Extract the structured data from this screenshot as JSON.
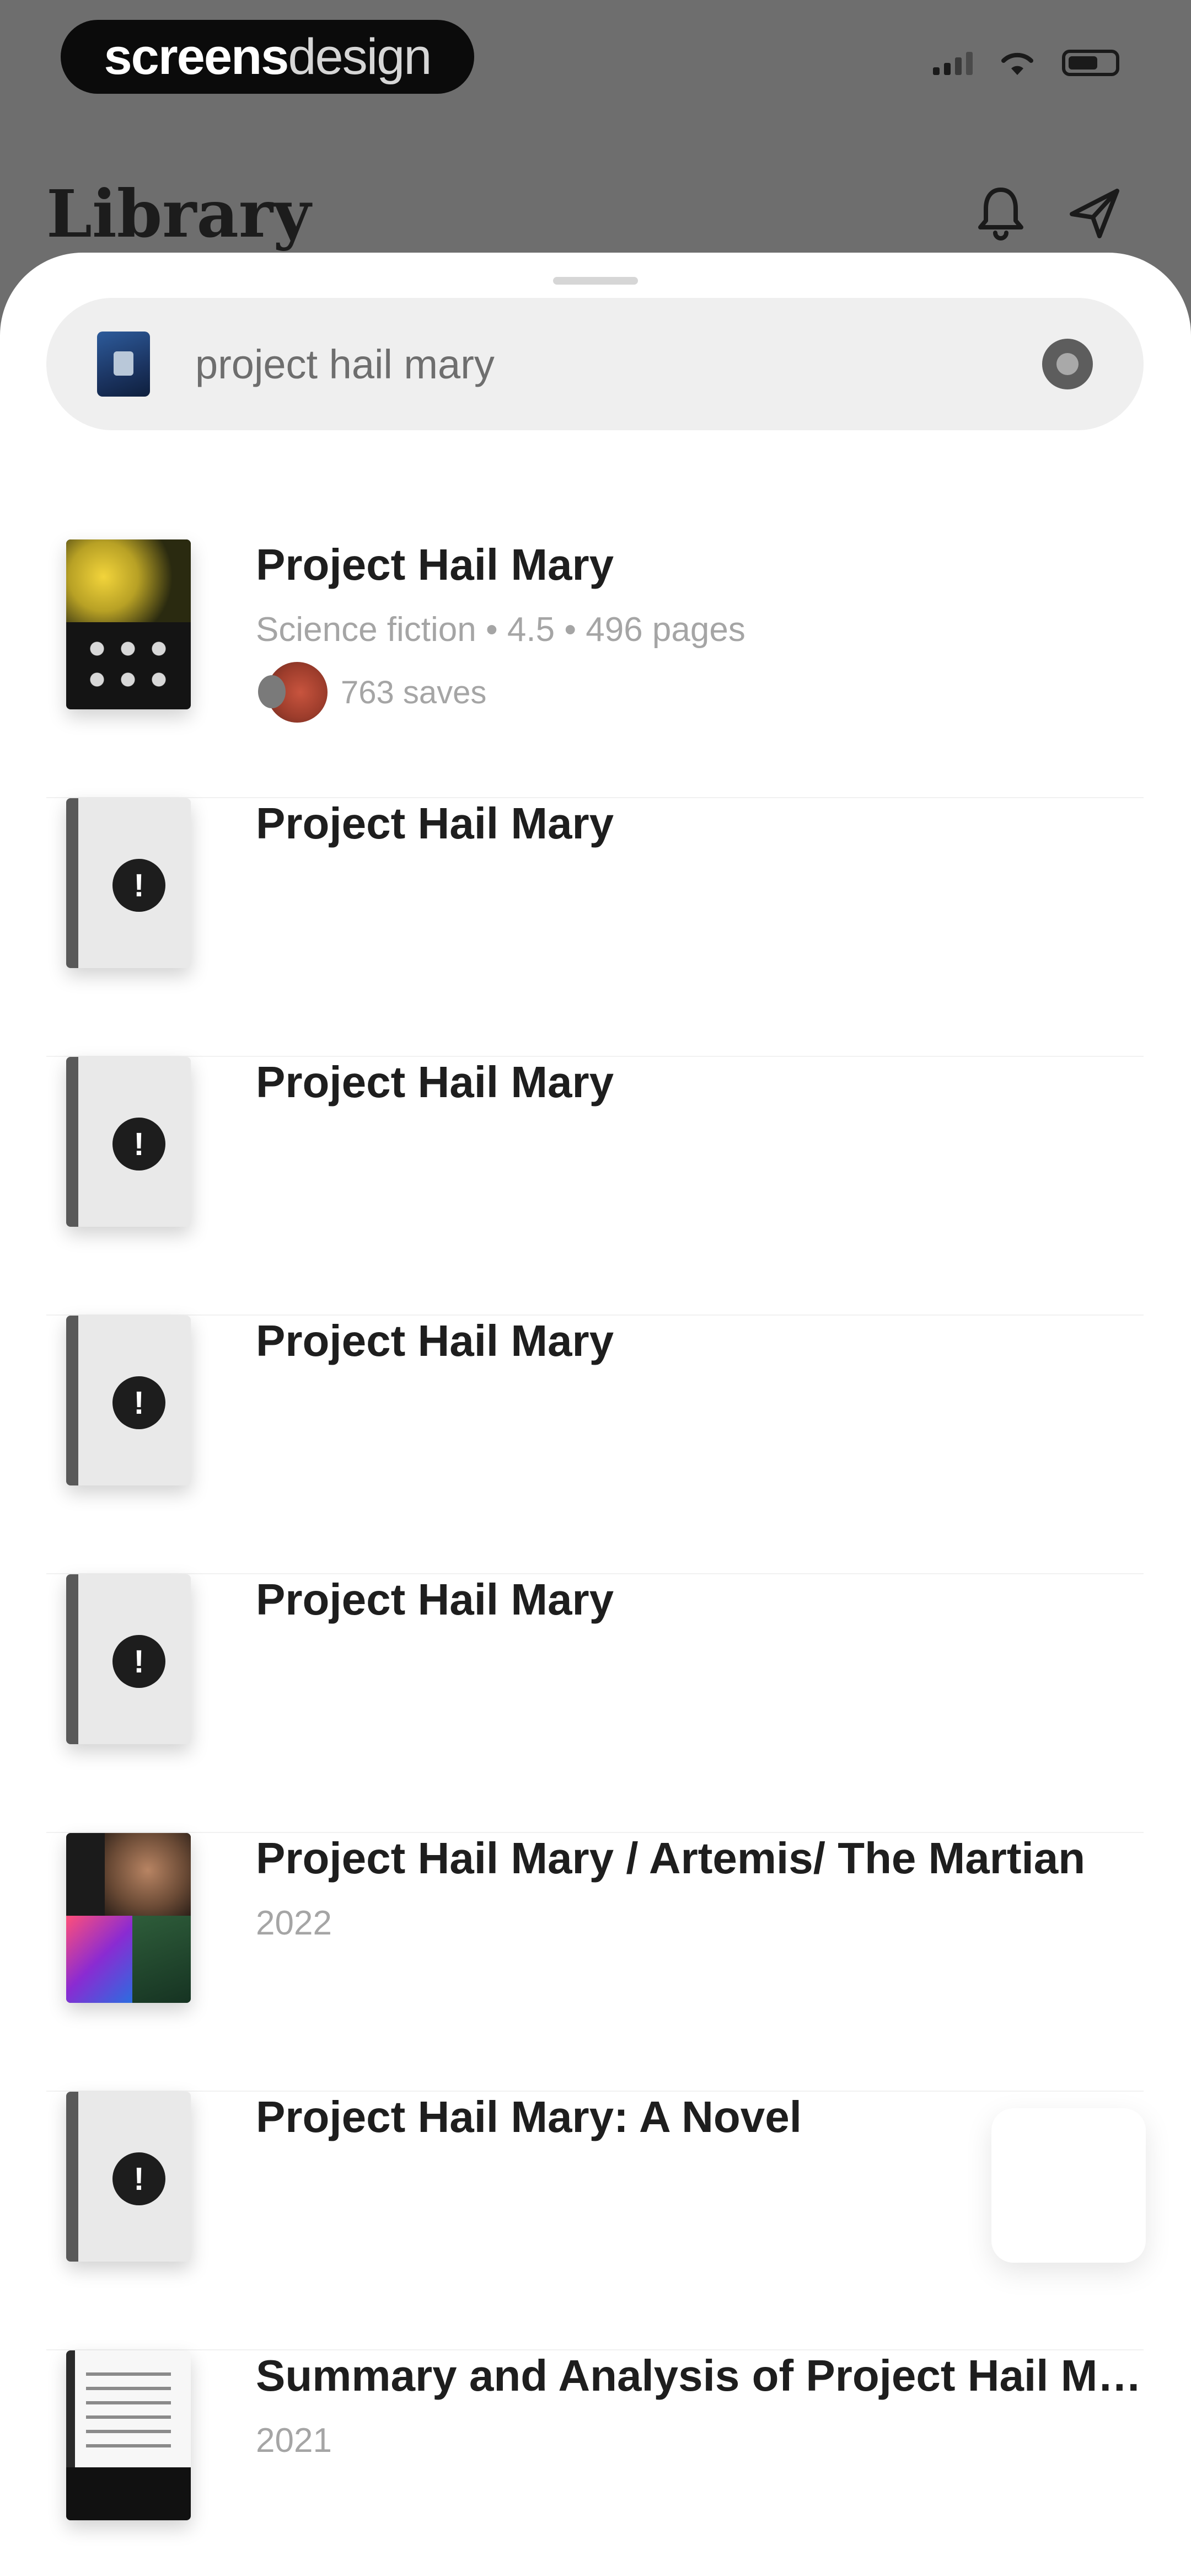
{
  "status_bar": {
    "brand_strong": "screens",
    "brand_light": "design"
  },
  "header": {
    "title": "Library",
    "icons": [
      "bell-icon",
      "send-icon"
    ]
  },
  "search": {
    "value": "project hail mary",
    "placeholder": "Search"
  },
  "results": [
    {
      "title": "Project Hail Mary",
      "meta": "Science fiction • 4.5 • 496 pages",
      "saves": "763 saves",
      "cover": "project-hail-mary-cover"
    },
    {
      "title": "Project Hail Mary",
      "cover": "placeholder"
    },
    {
      "title": "Project Hail Mary",
      "cover": "placeholder"
    },
    {
      "title": "Project Hail Mary",
      "cover": "placeholder"
    },
    {
      "title": "Project Hail Mary",
      "cover": "placeholder"
    },
    {
      "title": "Project Hail Mary / Artemis/ The Martian",
      "meta": "2022",
      "cover": "collection-cover"
    },
    {
      "title": "Project Hail Mary: A Novel",
      "cover": "placeholder"
    },
    {
      "title": "Summary and Analysis of Project Hail Mary",
      "meta": "2021",
      "cover": "summary-cover"
    }
  ],
  "placeholder_badge": "!"
}
